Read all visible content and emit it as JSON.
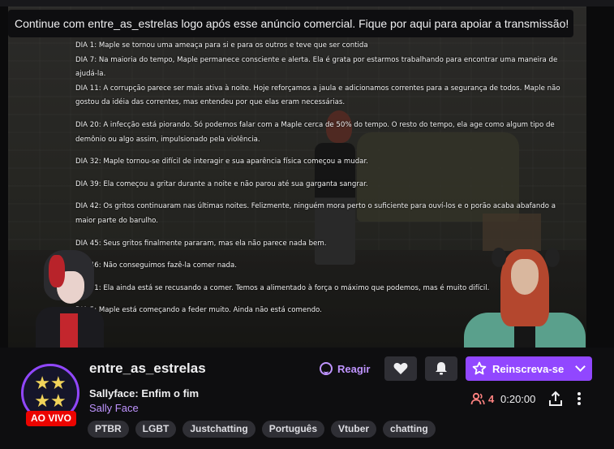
{
  "ad_banner": {
    "text": "Continue com entre_as_estrelas logo após esse anúncio comercial. Fique por aqui para apoiar a transmissão!"
  },
  "game_text": {
    "entries": [
      "DIA 1: Maple se tornou uma ameaça para si e para os outros e teve que ser contida",
      "DIA 7: Na maioria do tempo, Maple permanece consciente e alerta. Ela é grata por estarmos trabalhando para encontrar uma maneira de ajudá-la.",
      "DIA 11: A corrupção parece ser mais ativa à noite. Hoje reforçamos a jaula e adicionamos correntes para a segurança de todos. Maple não gostou da idéia das correntes, mas entendeu por que elas eram necessárias.",
      "DIA 20: A infecção está piorando. Só podemos falar com a Maple cerca de 50% do tempo. O resto do tempo, ela age como algum tipo de demônio ou algo assim, impulsionado pela violência.",
      "DIA 32: Maple tornou-se difícil de interagir e sua aparência física começou a mudar.",
      "DIA 39: Ela começou a gritar durante a noite e não parou até sua garganta sangrar.",
      "DIA 42: Os gritos continuaram nas últimas noites. Felizmente, ninguém mora perto o suficiente para ouví-los e o porão acaba abafando a maior parte do barulho.",
      "DIA 45: Seus gritos finalmente pararam, mas ela não parece nada bem.",
      "DIA 46: Não conseguimos fazê-la comer nada.",
      "DIA 51: Ela ainda está se recusando a comer. Temos a alimentado à força o máximo que podemos, mas é muito difícil.",
      "DIA 5: Maple está começando a feder muito. Ainda não está comendo."
    ]
  },
  "channel": {
    "name": "entre_as_estrelas",
    "live_badge": "AO VIVO",
    "stream_title": "Sallyface: Enfim o fim",
    "game": "Sally Face",
    "viewers": "4",
    "uptime": "0:20:00"
  },
  "actions": {
    "react_label": "Reagir",
    "subscribe_label": "Reinscreva-se"
  },
  "tags": [
    "PTBR",
    "LGBT",
    "Justchatting",
    "Português",
    "Vtuber",
    "chatting"
  ],
  "colors": {
    "accent": "#9147ff",
    "accent_text": "#bf94ff",
    "live": "#eb0400",
    "viewers": "#ff8280"
  }
}
